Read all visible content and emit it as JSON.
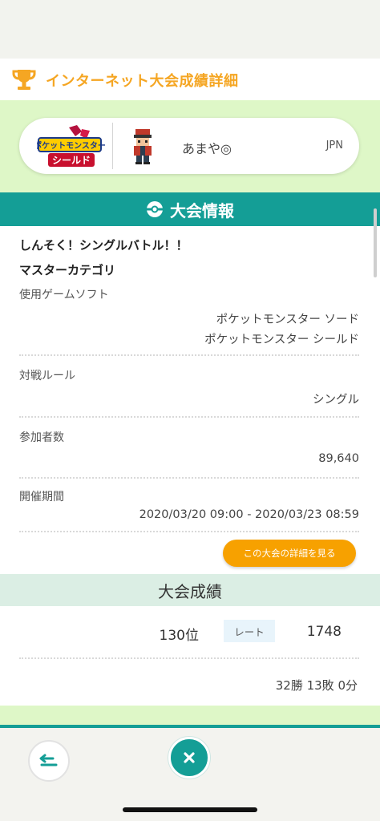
{
  "header": {
    "title": "インターネット大会成績詳細",
    "icon": "trophy-icon"
  },
  "player": {
    "game_logo_line1": "ポケットモンスター",
    "game_logo_line2": "シールド",
    "name": "あまや◎",
    "region": "JPN"
  },
  "section": {
    "title": "大会情報",
    "icon": "pokeball-icon"
  },
  "tournament": {
    "name": "しんそく！シングルバトル！！",
    "category": "マスターカテゴリ",
    "software_label": "使用ゲームソフト",
    "software_values": [
      "ポケットモンスター ソード",
      "ポケットモンスター シールド"
    ],
    "rule_label": "対戦ルール",
    "rule_value": "シングル",
    "participants_label": "参加者数",
    "participants_value": "89,640",
    "period_label": "開催期間",
    "period_value": "2020/03/20 09:00 - 2020/03/23 08:59",
    "detail_button": "この大会の詳細を見る"
  },
  "results": {
    "title": "大会成績",
    "rank": "130位",
    "rate_label": "レート",
    "rate_value": "1748",
    "record": "32勝 13敗 0分"
  },
  "footer": {
    "back_icon": "back-icon",
    "close_icon": "close-icon"
  },
  "colors": {
    "accent_orange": "#f5a623",
    "teal": "#149e96",
    "light_green": "#def7c7",
    "button_orange": "#f7a100"
  }
}
